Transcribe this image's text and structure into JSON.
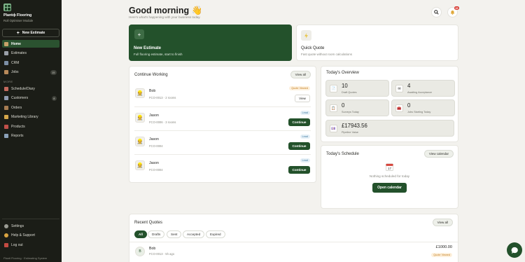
{
  "sidebar": {
    "brand": "Plantф Flooring",
    "subtitle": "Roll Optimiser Module",
    "new_estimate": "New Estimate",
    "section_label": "MORE",
    "items": [
      {
        "label": "Home"
      },
      {
        "label": "Estimates"
      },
      {
        "label": "CRM"
      },
      {
        "label": "Jobs",
        "badge": "15"
      },
      {
        "label": "Schedule/Diary"
      },
      {
        "label": "Customers",
        "badge": "8"
      },
      {
        "label": "Orders"
      },
      {
        "label": "Marketing Library"
      },
      {
        "label": "Products"
      },
      {
        "label": "Reports"
      }
    ],
    "bottom": [
      {
        "label": "Settings"
      },
      {
        "label": "Help & Support"
      },
      {
        "label": "Log out"
      }
    ],
    "footer": "Planti Flooring · Estimating System"
  },
  "header": {
    "greeting": "Good morning 👋",
    "subtitle": "Here's what's happening with your business today.",
    "notification_count": "15"
  },
  "new_estimate_card": {
    "title": "New Estimate",
    "subtitle": "Full flooring estimate, start to finish"
  },
  "quick_quote_card": {
    "title": "Quick Quote",
    "subtitle": "Fast quote without room calculations"
  },
  "continue_working": {
    "title": "Continue Working",
    "view_all": "View all",
    "rows": [
      {
        "name": "Bob",
        "meta": "FCO-0013 · 2 rooms",
        "status": "Quote Viewed",
        "action": "View"
      },
      {
        "name": "Jason",
        "meta": "FCO-0006 · 3 rooms",
        "status": "Lead",
        "action": "Continue"
      },
      {
        "name": "Jason",
        "meta": "FCO-0004",
        "status": "Lead",
        "action": "Continue"
      },
      {
        "name": "Jason",
        "meta": "FCO-0004",
        "status": "Lead",
        "action": "Continue"
      }
    ]
  },
  "overview": {
    "title": "Today's Overview",
    "tiles": [
      {
        "value": "10",
        "label": "Draft Quotes"
      },
      {
        "value": "4",
        "label": "Awaiting Acceptance"
      },
      {
        "value": "0",
        "label": "Surveys Today"
      },
      {
        "value": "0",
        "label": "Jobs Starting Today"
      },
      {
        "value": "£17943.56",
        "label": "Pipeline Value"
      }
    ]
  },
  "schedule": {
    "title": "Today's Schedule",
    "view_calendar": "View calendar",
    "empty_text": "Nothing scheduled for today",
    "open_calendar": "Open calendar",
    "calendar_day": "17"
  },
  "recent_quotes": {
    "title": "Recent Quotes",
    "view_all": "View all",
    "filters": [
      "All",
      "Drafts",
      "Sent",
      "Accepted",
      "Expired"
    ],
    "rows": [
      {
        "initial": "B",
        "name": "Bob",
        "meta": "FCO-0013 · 5h ago",
        "amount": "£1000.00",
        "status": "Quote Viewed"
      }
    ]
  },
  "colors": {
    "primary": "#23512b",
    "sidebar_bg": "#1b1d17",
    "page_bg": "#f3f2ee",
    "notification": "#d83a32"
  }
}
